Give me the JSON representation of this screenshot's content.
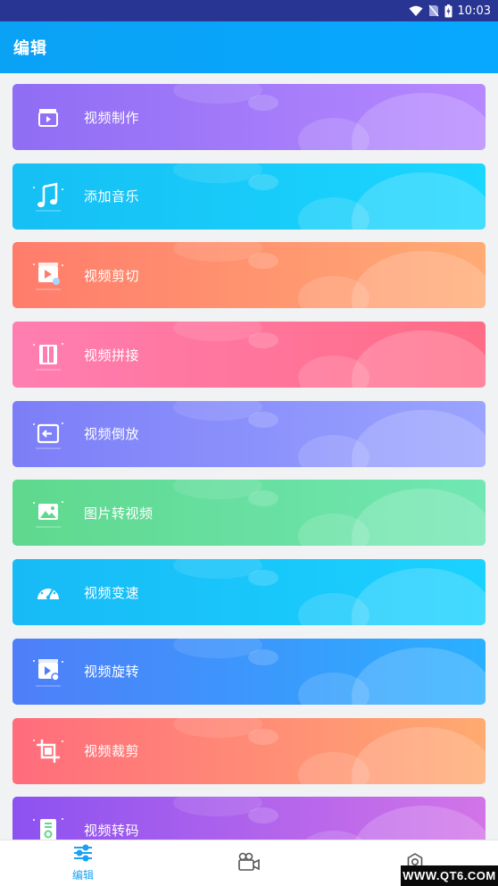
{
  "status": {
    "time": "10:03"
  },
  "header": {
    "title": "编辑"
  },
  "cards": [
    {
      "label": "视频制作",
      "icon": "clapperboard-icon"
    },
    {
      "label": "添加音乐",
      "icon": "music-note-icon"
    },
    {
      "label": "视频剪切",
      "icon": "video-cut-icon"
    },
    {
      "label": "视频拼接",
      "icon": "film-splice-icon"
    },
    {
      "label": "视频倒放",
      "icon": "reverse-play-icon"
    },
    {
      "label": "图片转视频",
      "icon": "image-to-video-icon"
    },
    {
      "label": "视频变速",
      "icon": "speedometer-icon"
    },
    {
      "label": "视频旋转",
      "icon": "rotate-video-icon"
    },
    {
      "label": "视频裁剪",
      "icon": "crop-icon"
    },
    {
      "label": "视频转码",
      "icon": "transcode-icon"
    }
  ],
  "bottom_nav": [
    {
      "label": "编辑",
      "icon": "sliders-icon",
      "active": true
    },
    {
      "label": "",
      "icon": "video-camera-icon",
      "active": false
    },
    {
      "label": "",
      "icon": "settings-icon",
      "active": false
    }
  ],
  "watermark": {
    "text": "WWW.QT6.COM"
  },
  "colors": {
    "accent": "#1aa2f2",
    "status_bar": "#283593"
  }
}
